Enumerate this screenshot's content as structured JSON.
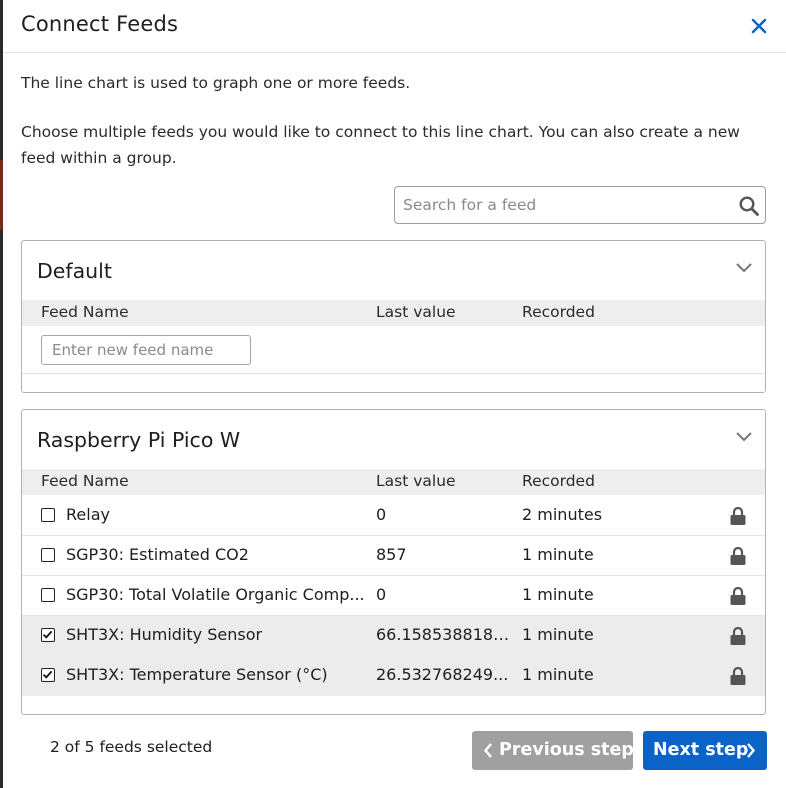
{
  "dialog": {
    "title": "Connect Feeds",
    "close_icon": "close-icon",
    "description": "The line chart is used to graph one or more feeds.",
    "instructions": "Choose multiple feeds you would like to connect to this line chart. You can also create a new feed within a group."
  },
  "search": {
    "placeholder": "Search for a feed",
    "icon": "search-icon"
  },
  "columns": {
    "feed_name": "Feed Name",
    "last_value": "Last value",
    "recorded": "Recorded"
  },
  "groups": [
    {
      "name": "Default",
      "new_feed_placeholder": "Enter new feed name",
      "feeds": []
    },
    {
      "name": "Raspberry Pi Pico W",
      "feeds": [
        {
          "name": "Relay",
          "last_value": "0",
          "recorded": "2 minutes",
          "checked": false,
          "locked": true
        },
        {
          "name": "SGP30: Estimated CO2",
          "last_value": "857",
          "recorded": "1 minute",
          "checked": false,
          "locked": true
        },
        {
          "name": "SGP30: Total Volatile Organic Comp...",
          "last_value": "0",
          "recorded": "1 minute",
          "checked": false,
          "locked": true
        },
        {
          "name": "SHT3X: Humidity Sensor",
          "last_value": "66.1585388183...",
          "recorded": "1 minute",
          "checked": true,
          "locked": true
        },
        {
          "name": "SHT3X: Temperature Sensor (°C)",
          "last_value": "26.532768249...",
          "recorded": "1 minute",
          "checked": true,
          "locked": true
        }
      ]
    }
  ],
  "footer": {
    "selection_status": "2 of 5 feeds selected",
    "previous_label": "Previous step",
    "next_label": "Next step"
  },
  "colors": {
    "primary": "#0b63c8",
    "disabled": "#a0a0a0",
    "selected_row": "#ececec",
    "close_icon": "#0b63c8"
  }
}
